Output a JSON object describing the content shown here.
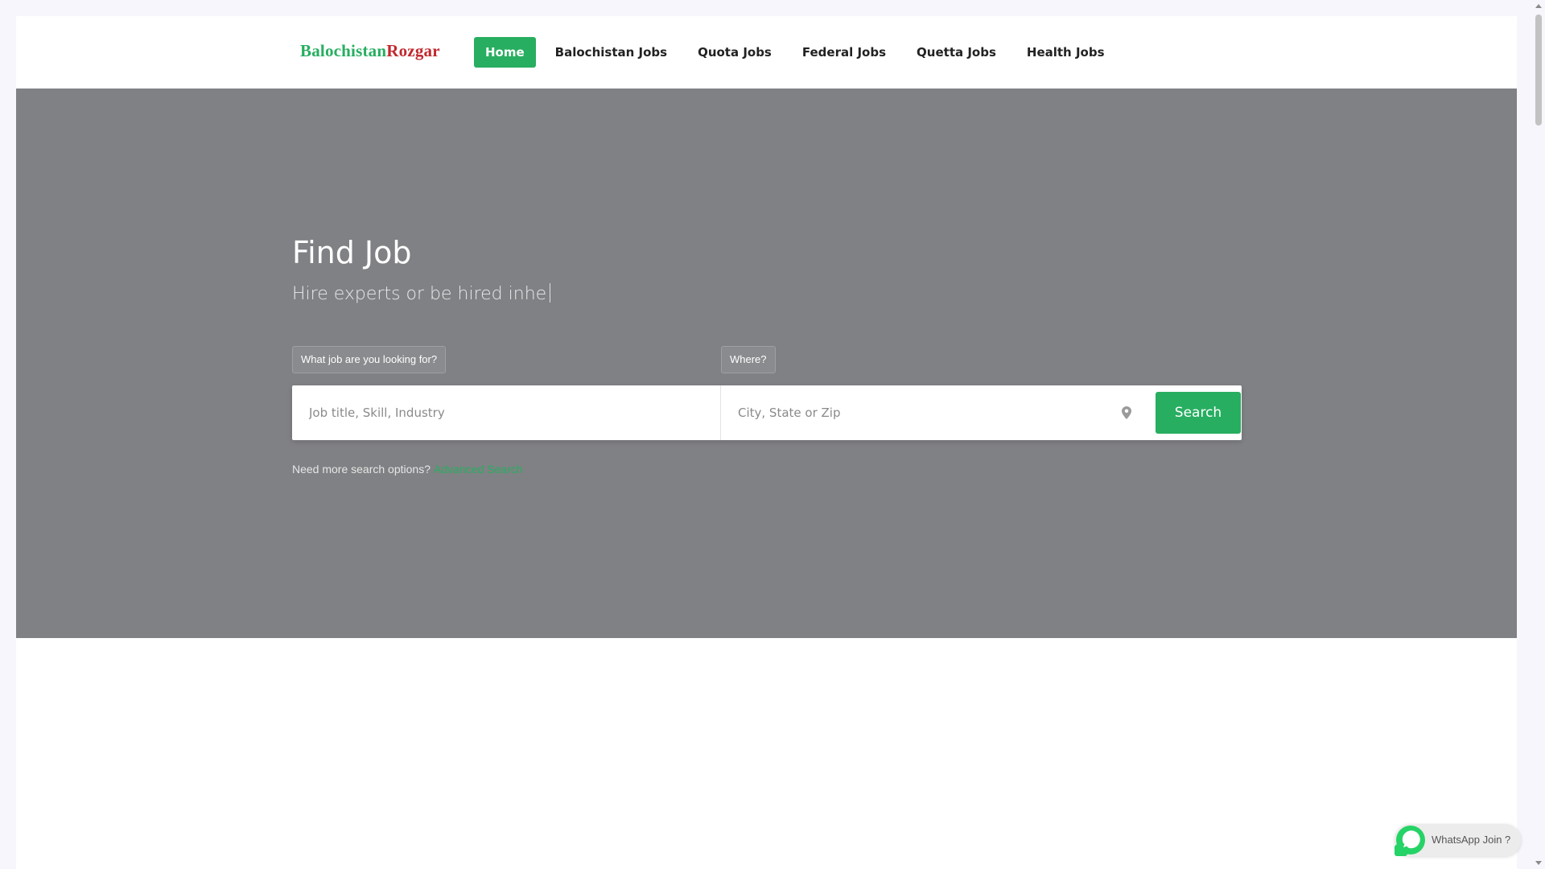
{
  "brand": {
    "part1": "Balochistan",
    "part2": "Rozgar",
    "color1": "#27ae60",
    "color2": "#c0282d"
  },
  "nav": {
    "items": [
      {
        "label": "Home",
        "active": true
      },
      {
        "label": "Balochistan Jobs"
      },
      {
        "label": "Quota Jobs"
      },
      {
        "label": "Federal Jobs"
      },
      {
        "label": "Quetta Jobs"
      },
      {
        "label": "Health Jobs"
      }
    ]
  },
  "hero": {
    "title": "Find Job",
    "subtitle": "Hire experts or be hired inhe",
    "background": "#808184"
  },
  "search": {
    "what_label": "What job are you looking for?",
    "where_label": "Where?",
    "job_placeholder": "Job title, Skill, Industry",
    "location_placeholder": "City, State or Zip",
    "location_icon": "map-pin-icon",
    "button_label": "Search",
    "more_text": "Need more search options?",
    "advanced_link": "Advanced Search"
  },
  "whatsapp": {
    "label": "WhatsApp Join ?",
    "icon": "whatsapp-icon",
    "color": "#25d366"
  },
  "theme": {
    "accent": "#27ae60"
  }
}
